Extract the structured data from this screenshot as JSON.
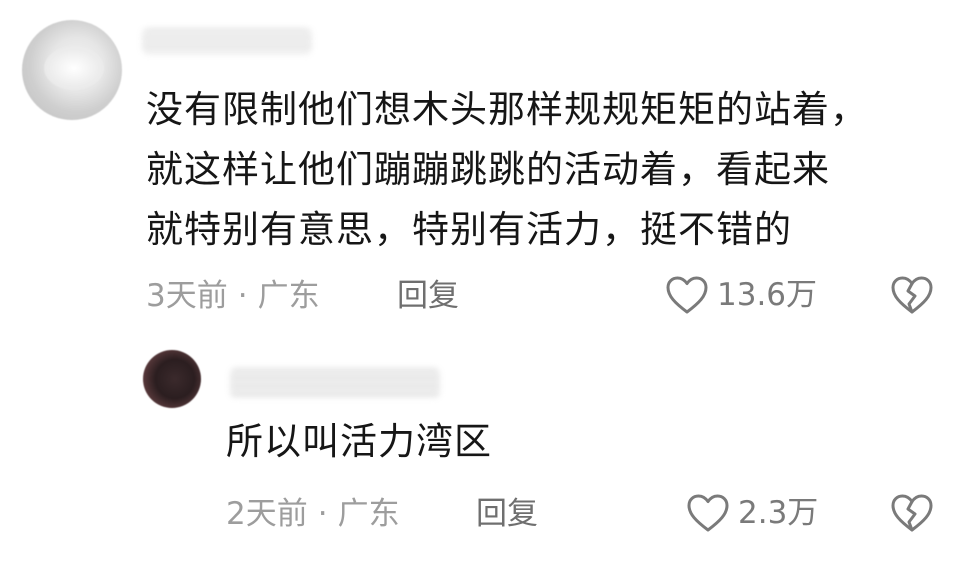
{
  "comment": {
    "lines": [
      "没有限制他们想木头那样规规矩矩的站着，",
      "就这样让他们蹦蹦跳跳的活动着，看起来",
      "就特别有意思，特别有活力，挺不错的"
    ],
    "time": "3天前",
    "separator": "·",
    "location": "广东",
    "reply_label": "回复",
    "likes": "13.6万"
  },
  "reply": {
    "text": "所以叫活力湾区",
    "time": "2天前",
    "separator": "·",
    "location": "广东",
    "reply_label": "回复",
    "likes": "2.3万"
  },
  "icons": {
    "like": "heart-outline-icon",
    "dislike": "broken-heart-icon"
  },
  "colors": {
    "text": "#161616",
    "meta": "#9d9d9d",
    "icon": "#7a7a7a"
  }
}
